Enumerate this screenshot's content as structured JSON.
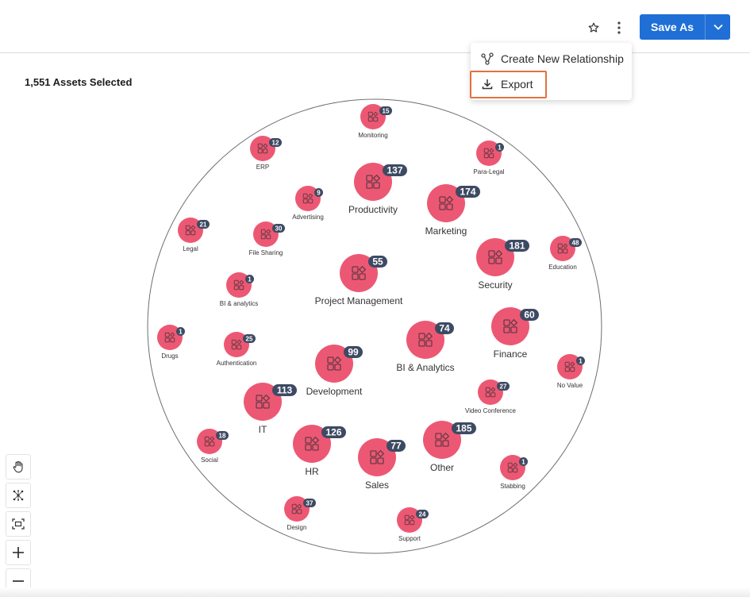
{
  "toolbar": {
    "star_icon": "star-outline-icon",
    "more_icon": "kebab-vertical-icon",
    "save_as_label": "Save As",
    "dropdown_icon": "chevron-down-icon"
  },
  "menu": {
    "items": [
      {
        "label": "Create New Relationship",
        "icon": "relationship-icon"
      },
      {
        "label": "Export",
        "icon": "download-icon"
      }
    ]
  },
  "summary": {
    "assets_selected": "1,551 Assets Selected"
  },
  "colors": {
    "node": "#ec5873",
    "badge": "#3d4a63",
    "primary": "#1f6fd6",
    "highlight": "#e0733f"
  },
  "nodes": [
    {
      "label": "Monitoring",
      "count": "15",
      "size": "small"
    },
    {
      "label": "ERP",
      "count": "12",
      "size": "small"
    },
    {
      "label": "Para-Legal",
      "count": "1",
      "size": "small"
    },
    {
      "label": "Productivity",
      "count": "137",
      "size": "large"
    },
    {
      "label": "Advertising",
      "count": "9",
      "size": "small"
    },
    {
      "label": "Marketing",
      "count": "174",
      "size": "large"
    },
    {
      "label": "Legal",
      "count": "21",
      "size": "small"
    },
    {
      "label": "File Sharing",
      "count": "30",
      "size": "small"
    },
    {
      "label": "Security",
      "count": "181",
      "size": "large"
    },
    {
      "label": "Education",
      "count": "48",
      "size": "small"
    },
    {
      "label": "Project Management",
      "count": "55",
      "size": "large"
    },
    {
      "label": "BI & analytics",
      "count": "1",
      "size": "small"
    },
    {
      "label": "Finance",
      "count": "60",
      "size": "large"
    },
    {
      "label": "Drugs",
      "count": "1",
      "size": "small"
    },
    {
      "label": "Authentication",
      "count": "25",
      "size": "small"
    },
    {
      "label": "BI & Analytics",
      "count": "74",
      "size": "large"
    },
    {
      "label": "Development",
      "count": "99",
      "size": "large"
    },
    {
      "label": "No Value",
      "count": "1",
      "size": "small"
    },
    {
      "label": "Video Conference",
      "count": "27",
      "size": "small"
    },
    {
      "label": "IT",
      "count": "113",
      "size": "large"
    },
    {
      "label": "Social",
      "count": "18",
      "size": "small"
    },
    {
      "label": "HR",
      "count": "126",
      "size": "large"
    },
    {
      "label": "Other",
      "count": "185",
      "size": "large"
    },
    {
      "label": "Sales",
      "count": "77",
      "size": "large"
    },
    {
      "label": "Stabbing",
      "count": "1",
      "size": "small"
    },
    {
      "label": "Design",
      "count": "37",
      "size": "small"
    },
    {
      "label": "Support",
      "count": "24",
      "size": "small"
    }
  ],
  "tools": [
    {
      "name": "pan-hand-icon"
    },
    {
      "name": "network-layout-icon"
    },
    {
      "name": "fit-to-screen-icon"
    },
    {
      "name": "zoom-in-icon"
    },
    {
      "name": "zoom-out-icon"
    }
  ]
}
